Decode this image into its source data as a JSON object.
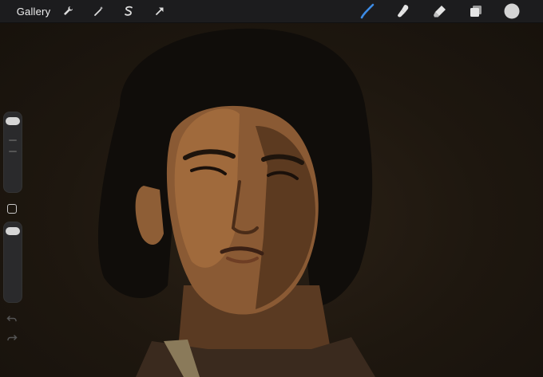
{
  "toolbar": {
    "gallery_label": "Gallery",
    "left_icons": [
      "wrench-icon",
      "magic-wand-icon",
      "selection-s-icon",
      "transform-arrow-icon"
    ],
    "right_icons": [
      "brush-icon",
      "smudge-icon",
      "eraser-icon",
      "layers-icon",
      "color-swatch-icon"
    ],
    "accent_color": "#3d8ce6",
    "active_color": "#f2f2f2"
  },
  "sidebar": {
    "brush_size": 0.95,
    "opacity": 0.95
  },
  "canvas": {
    "background_color": "#1e170f"
  }
}
